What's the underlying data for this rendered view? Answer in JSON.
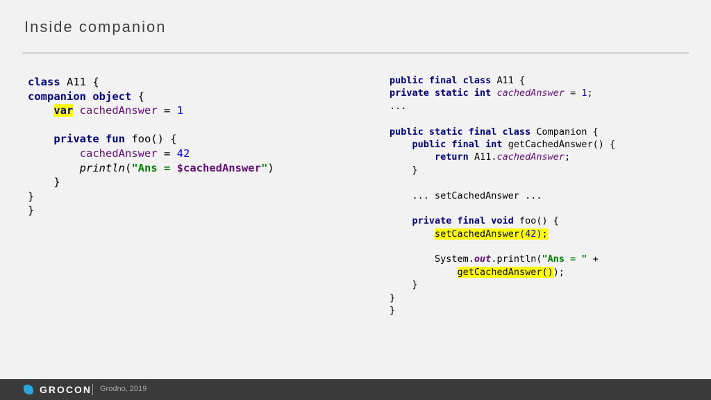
{
  "slide": {
    "title": "Inside companion"
  },
  "kotlin_code": {
    "lines": [
      [
        {
          "t": "class",
          "c": "kw"
        },
        {
          "t": " A11 {"
        }
      ],
      [
        {
          "t": "companion object",
          "c": "kw"
        },
        {
          "t": " {"
        }
      ],
      [
        {
          "t": "    "
        },
        {
          "t": "var",
          "c": "kw hl"
        },
        {
          "t": " "
        },
        {
          "t": "cachedAnswer",
          "c": "fld"
        },
        {
          "t": " = "
        },
        {
          "t": "1",
          "c": "num"
        }
      ],
      [],
      [
        {
          "t": "    "
        },
        {
          "t": "private fun",
          "c": "kw"
        },
        {
          "t": " foo() {"
        }
      ],
      [
        {
          "t": "        "
        },
        {
          "t": "cachedAnswer",
          "c": "fld"
        },
        {
          "t": " = "
        },
        {
          "t": "42",
          "c": "num"
        }
      ],
      [
        {
          "t": "        "
        },
        {
          "t": "println",
          "c": "it"
        },
        {
          "t": "("
        },
        {
          "t": "\"Ans = ",
          "c": "str"
        },
        {
          "t": "$cachedAnswer",
          "c": "fld kw"
        },
        {
          "t": "\"",
          "c": "str"
        },
        {
          "t": ")"
        }
      ],
      [
        {
          "t": "    }"
        }
      ],
      [
        {
          "t": "}"
        }
      ],
      [
        {
          "t": "}"
        }
      ]
    ]
  },
  "java_code": {
    "lines": [
      [
        {
          "t": "public final class",
          "c": "kw"
        },
        {
          "t": " A11 {"
        }
      ],
      [
        {
          "t": "private static int",
          "c": "kw"
        },
        {
          "t": " "
        },
        {
          "t": "cachedAnswer",
          "c": "fld it"
        },
        {
          "t": " = "
        },
        {
          "t": "1",
          "c": "num"
        },
        {
          "t": ";"
        }
      ],
      [
        {
          "t": "..."
        }
      ],
      [],
      [
        {
          "t": "public static final class",
          "c": "kw"
        },
        {
          "t": " Companion {"
        }
      ],
      [
        {
          "t": "    "
        },
        {
          "t": "public final int",
          "c": "kw"
        },
        {
          "t": " getCachedAnswer() {"
        }
      ],
      [
        {
          "t": "        "
        },
        {
          "t": "return",
          "c": "kw"
        },
        {
          "t": " A11."
        },
        {
          "t": "cachedAnswer",
          "c": "fld it"
        },
        {
          "t": ";"
        }
      ],
      [
        {
          "t": "    }"
        }
      ],
      [],
      [
        {
          "t": "    ... setCachedAnswer ..."
        }
      ],
      [],
      [
        {
          "t": "    "
        },
        {
          "t": "private final void",
          "c": "kw"
        },
        {
          "t": " foo() {"
        }
      ],
      [
        {
          "t": "        "
        },
        {
          "t": "setCachedAnswer(",
          "c": "hl"
        },
        {
          "t": "42",
          "c": "num hl"
        },
        {
          "t": ");",
          "c": "hl"
        }
      ],
      [],
      [
        {
          "t": "        System."
        },
        {
          "t": "out",
          "c": "fld it kw"
        },
        {
          "t": ".println("
        },
        {
          "t": "\"Ans = \"",
          "c": "str"
        },
        {
          "t": " +"
        }
      ],
      [
        {
          "t": "            "
        },
        {
          "t": "getCachedAnswer()",
          "c": "hl"
        },
        {
          "t": ");"
        }
      ],
      [
        {
          "t": "    }"
        }
      ],
      [
        {
          "t": "}"
        }
      ],
      [
        {
          "t": "}"
        }
      ]
    ]
  },
  "footer": {
    "brand": "GROCON",
    "city": "Grodno, 2019",
    "logo_icon": "grocon-logo-icon",
    "accent_color": "#2aa6df"
  },
  "colors": {
    "keyword": "#000080",
    "field": "#660e7a",
    "number": "#0000ff",
    "string": "#008000",
    "highlight": "#ffff00",
    "background": "#f2f2f2",
    "footer_bg": "#3a3a3a"
  }
}
